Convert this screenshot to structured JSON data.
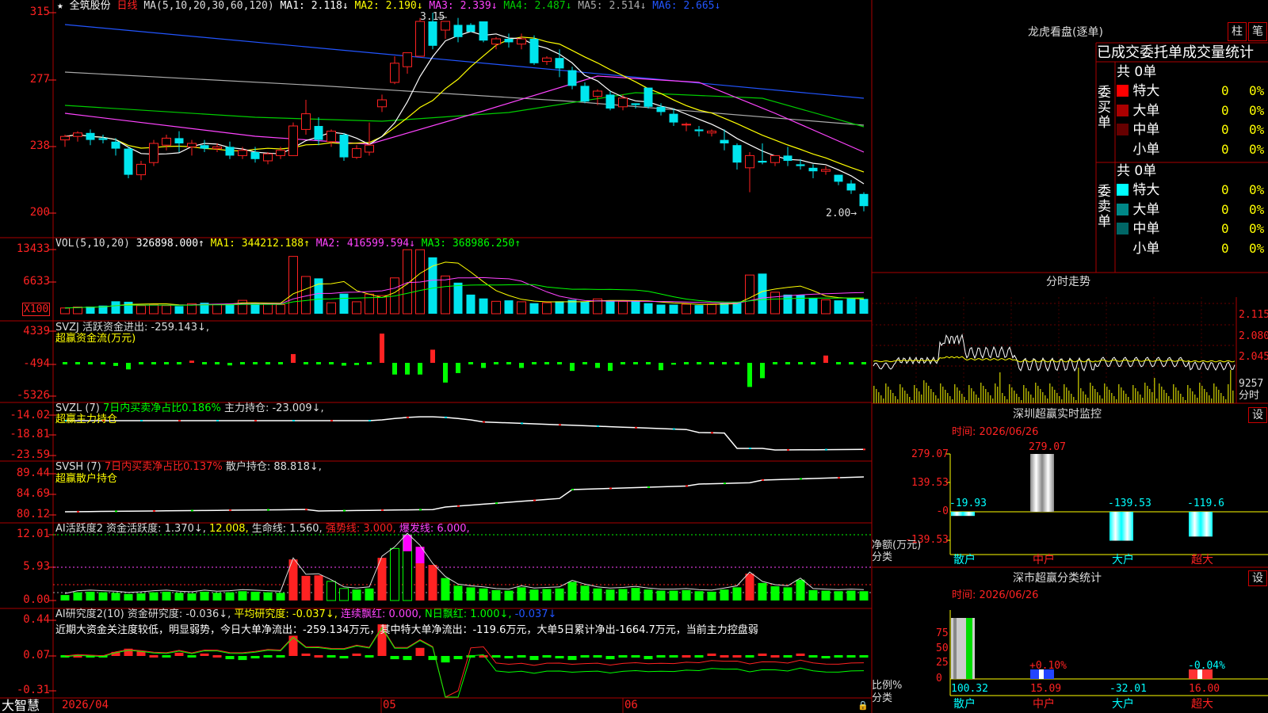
{
  "colors": {
    "up": "#ff2222",
    "down": "#00e5ee",
    "ma1": "#ffffff",
    "ma2": "#ffff00",
    "ma3": "#ff44ff",
    "ma4": "#00cc00",
    "ma5": "#aaaaaa",
    "ma6": "#2255ff",
    "grid": "#aa0000",
    "green_bar": "#00ff00"
  },
  "main": {
    "star": "★",
    "stock_name": "全筑股份",
    "period": "日线",
    "ma_head": "MA(5,10,20,30,60,120)",
    "ma_items": [
      {
        "label": "MA1:",
        "value": "2.118↓"
      },
      {
        "label": "MA2:",
        "value": "2.190↓"
      },
      {
        "label": "MA3:",
        "value": "2.339↓"
      },
      {
        "label": "MA4:",
        "value": "2.487↓"
      },
      {
        "label": "MA5:",
        "value": "2.514↓"
      },
      {
        "label": "MA6:",
        "value": "2.665↓"
      }
    ],
    "high_label": "3.15",
    "low_label": "2.00→",
    "y_ticks": [
      "315",
      "277",
      "238",
      "200"
    ]
  },
  "vol": {
    "head": "VOL(5,10,20)",
    "value": "326898.000↑",
    "ma1": "MA1: 344212.188↑",
    "ma2": "MA2: 416599.594↓",
    "ma3": "MA3: 368986.250↑",
    "y_ticks": [
      "13433",
      "6633"
    ],
    "unit": "X100"
  },
  "svzj": {
    "head": "SVZJ  活跃资金进出: -259.143↓,",
    "sub": "超赢资金流(万元)",
    "y_ticks": [
      "4339",
      "-494",
      "-5326"
    ]
  },
  "svzl": {
    "head": "SVZL (7)",
    "ratio": "7日内买卖净占比0.186%",
    "hold": "主力持仓: -23.009↓,",
    "sub": "超赢主力持仓",
    "y_ticks": [
      "-14.02",
      "-18.81",
      "-23.59"
    ]
  },
  "svsh": {
    "head": "SVSH (7)",
    "ratio": "7日内买卖净占比0.137%",
    "hold": "散户持仓: 88.818↓,",
    "sub": "超赢散户持仓",
    "y_ticks": [
      "89.44",
      "84.69",
      "80.12"
    ]
  },
  "ai1": {
    "head": "AI活跃度2 资金活跃度: 1.370↓,",
    "v1": "12.008,",
    "v2": "生命线: 1.560,",
    "v3": "强势线: 3.000,",
    "v4": "爆发线: 6.000,",
    "y_ticks": [
      "12.01",
      "5.93",
      "0.00"
    ]
  },
  "ai2": {
    "head": "AI研究度2(10) 资金研究度: -0.036↓,",
    "v1": "平均研究度: -0.037↓,",
    "v2": "连续飘红: 0.000,",
    "v3": "N日飘红: 1.000↓,",
    "v4": "-0.037↓",
    "comment": "近期大资金关注度较低，明显弱势，今日大单净流出：-259.134万元，其中特大单净流出：-119.6万元，大单5日累计净出-1664.7万元，当前主力控盘弱",
    "y_ticks": [
      "0.44",
      "0.07",
      "-0.31"
    ]
  },
  "bottom": {
    "brand": "大智慧",
    "dates": [
      "2026/04",
      "05",
      "06"
    ]
  },
  "lhb": {
    "title": "龙虎看盘(逐单)",
    "btn1": "柱",
    "btn2": "笔",
    "header": "已成交委托单成交量统计",
    "buy_label": "委买单",
    "sell_label": "委卖单",
    "buy_total": "共 0单",
    "sell_total": "共 0单",
    "buy_rows": [
      {
        "name": "特大",
        "count": "0",
        "pct": "0%"
      },
      {
        "name": "大单",
        "count": "0",
        "pct": "0%"
      },
      {
        "name": "中单",
        "count": "0",
        "pct": "0%"
      },
      {
        "name": "小单",
        "count": "0",
        "pct": "0%"
      }
    ],
    "sell_rows": [
      {
        "name": "特大",
        "count": "0",
        "pct": "0%"
      },
      {
        "name": "大单",
        "count": "0",
        "pct": "0%"
      },
      {
        "name": "中单",
        "count": "0",
        "pct": "0%"
      },
      {
        "name": "小单",
        "count": "0",
        "pct": "0%"
      }
    ]
  },
  "fenshi": {
    "title": "分时走势",
    "y_ticks": [
      "2.115",
      "2.080",
      "2.045"
    ],
    "vol_tick": "9257",
    "label": "分时"
  },
  "monitor": {
    "title": "深圳超赢实时监控",
    "btn": "设",
    "time": "时间: 2026/06/26",
    "y_ticks": [
      "279.07",
      "139.53",
      "-0",
      "-139.53"
    ],
    "axis_label1": "净额(万元)",
    "axis_label2": "分类",
    "categories": [
      "散户",
      "中户",
      "大户",
      "超大"
    ],
    "values": [
      -19.93,
      279.07,
      -139.53,
      -119.6
    ],
    "value_labels": [
      "-19.93",
      "279.07",
      "-139.53",
      "-119.6"
    ]
  },
  "classify": {
    "title": "深市超赢分类统计",
    "btn": "设",
    "time": "时间: 2026/06/26",
    "y_ticks": [
      "75",
      "50",
      "25",
      "0"
    ],
    "axis_label1": "比例%",
    "axis_label2": "分类",
    "categories": [
      "散户",
      "中户",
      "大户",
      "超大"
    ],
    "values": [
      100.32,
      15.09,
      -32.01,
      16.0
    ],
    "bottom_labels": [
      "100.32",
      "15.09",
      "-32.01",
      "16.00"
    ],
    "bar_labels": [
      "",
      "+0.10%",
      "",
      "-0.04%"
    ]
  },
  "chart_data": [
    {
      "type": "candlestick",
      "title": "全筑股份 日线",
      "ylim": [
        2.0,
        3.15
      ],
      "x_labels": [
        "2026/04",
        "05",
        "06"
      ],
      "ohlc": [
        [
          2.42,
          2.44,
          2.38,
          2.45
        ],
        [
          2.44,
          2.46,
          2.41,
          2.47
        ],
        [
          2.46,
          2.42,
          2.39,
          2.48
        ],
        [
          2.43,
          2.42,
          2.4,
          2.45
        ],
        [
          2.41,
          2.37,
          2.33,
          2.43
        ],
        [
          2.37,
          2.22,
          2.2,
          2.38
        ],
        [
          2.22,
          2.28,
          2.19,
          2.3
        ],
        [
          2.29,
          2.4,
          2.27,
          2.42
        ],
        [
          2.39,
          2.43,
          2.36,
          2.45
        ],
        [
          2.43,
          2.4,
          2.35,
          2.47
        ],
        [
          2.38,
          2.4,
          2.33,
          2.42
        ],
        [
          2.39,
          2.37,
          2.35,
          2.42
        ],
        [
          2.37,
          2.38,
          2.35,
          2.4
        ],
        [
          2.38,
          2.33,
          2.31,
          2.41
        ],
        [
          2.33,
          2.36,
          2.31,
          2.38
        ],
        [
          2.35,
          2.31,
          2.29,
          2.38
        ],
        [
          2.3,
          2.34,
          2.28,
          2.35
        ],
        [
          2.33,
          2.36,
          2.31,
          2.38
        ],
        [
          2.33,
          2.5,
          2.33,
          2.52
        ],
        [
          2.48,
          2.57,
          2.45,
          2.65
        ],
        [
          2.5,
          2.42,
          2.39,
          2.55
        ],
        [
          2.41,
          2.47,
          2.38,
          2.48
        ],
        [
          2.45,
          2.32,
          2.3,
          2.46
        ],
        [
          2.32,
          2.37,
          2.31,
          2.39
        ],
        [
          2.35,
          2.39,
          2.33,
          2.52
        ],
        [
          2.61,
          2.65,
          2.58,
          2.68
        ],
        [
          2.75,
          2.86,
          2.74,
          2.9
        ],
        [
          2.84,
          2.92,
          2.8,
          2.92
        ],
        [
          2.9,
          3.1,
          2.95,
          3.12
        ],
        [
          3.1,
          2.96,
          2.94,
          3.15
        ],
        [
          3.05,
          3.1,
          3.0,
          3.09
        ],
        [
          3.08,
          3.01,
          2.98,
          3.12
        ],
        [
          3.08,
          3.04,
          3.04,
          3.09
        ],
        [
          3.1,
          2.99,
          2.98,
          3.1
        ],
        [
          2.97,
          3.0,
          2.94,
          3.01
        ],
        [
          3.0,
          2.98,
          2.95,
          3.03
        ],
        [
          2.97,
          3.0,
          2.94,
          3.03
        ],
        [
          3.0,
          2.86,
          2.85,
          3.02
        ],
        [
          2.87,
          2.89,
          2.85,
          2.9
        ],
        [
          2.89,
          2.83,
          2.78,
          2.94
        ],
        [
          2.82,
          2.73,
          2.71,
          2.84
        ],
        [
          2.73,
          2.64,
          2.63,
          2.75
        ],
        [
          2.67,
          2.7,
          2.62,
          2.71
        ],
        [
          2.68,
          2.6,
          2.59,
          2.7
        ],
        [
          2.61,
          2.66,
          2.59,
          2.68
        ],
        [
          2.63,
          2.62,
          2.6,
          2.63
        ],
        [
          2.72,
          2.61,
          2.6,
          2.68
        ],
        [
          2.61,
          2.58,
          2.56,
          2.63
        ],
        [
          2.57,
          2.52,
          2.5,
          2.6
        ],
        [
          2.51,
          2.51,
          2.47,
          2.52
        ],
        [
          2.48,
          2.47,
          2.44,
          2.5
        ],
        [
          2.46,
          2.47,
          2.44,
          2.48
        ],
        [
          2.42,
          2.4,
          2.36,
          2.48
        ],
        [
          2.39,
          2.29,
          2.25,
          2.4
        ],
        [
          2.26,
          2.33,
          2.12,
          2.35
        ],
        [
          2.3,
          2.29,
          2.28,
          2.4
        ],
        [
          2.29,
          2.33,
          2.27,
          2.33
        ],
        [
          2.33,
          2.3,
          2.27,
          2.38
        ],
        [
          2.28,
          2.27,
          2.25,
          2.31
        ],
        [
          2.26,
          2.24,
          2.2,
          2.28
        ],
        [
          2.24,
          2.25,
          2.22,
          2.27
        ],
        [
          2.22,
          2.18,
          2.16,
          2.22
        ],
        [
          2.17,
          2.13,
          2.11,
          2.19
        ],
        [
          2.11,
          2.04,
          2.01,
          2.12
        ]
      ]
    },
    {
      "type": "bar",
      "title": "VOL(5,10,20)",
      "unit": "X100",
      "ylim": [
        0,
        13433
      ],
      "values": [
        1200,
        1400,
        1500,
        1700,
        2600,
        2500,
        1700,
        1900,
        1700,
        1600,
        2100,
        2300,
        2000,
        2100,
        2800,
        2200,
        2000,
        1900,
        12000,
        7800,
        7400,
        2300,
        4200,
        2500,
        4100,
        3800,
        7500,
        13400,
        13400,
        11800,
        7900,
        6500,
        4000,
        3200,
        2600,
        2800,
        2500,
        2200,
        2300,
        2600,
        2900,
        2500,
        3100,
        2800,
        2600,
        2700,
        2200,
        1900,
        1900,
        2000,
        1800,
        2000,
        2300,
        2500,
        8100,
        8400,
        4500,
        4000,
        3900,
        3300,
        2900,
        2800,
        3300,
        3100
      ]
    },
    {
      "type": "bar",
      "title": "SVZJ 活跃资金进出",
      "ylim": [
        -5326,
        4339
      ],
      "values": [
        -160,
        -160,
        -160,
        -160,
        -420,
        -900,
        -160,
        -160,
        -160,
        -160,
        300,
        -160,
        -160,
        -350,
        -160,
        -160,
        -160,
        -160,
        1200,
        -160,
        -160,
        -160,
        -380,
        -300,
        -160,
        4000,
        -1600,
        -1600,
        -1600,
        1800,
        -2700,
        -1400,
        -160,
        -700,
        -160,
        -160,
        -700,
        -160,
        -160,
        -160,
        -1100,
        -160,
        -700,
        -1100,
        -160,
        -160,
        -160,
        -1000,
        -250,
        -160,
        -160,
        -160,
        -160,
        -160,
        -3300,
        -2100,
        -160,
        -160,
        -160,
        -160,
        1000,
        -160,
        -160,
        -160,
        -160,
        -160,
        -160
      ]
    },
    {
      "type": "line",
      "title": "AI研究度2(10)",
      "ylim": [
        -0.31,
        0.44
      ],
      "x_labels": [
        "2026/04",
        "05",
        "06"
      ]
    }
  ]
}
